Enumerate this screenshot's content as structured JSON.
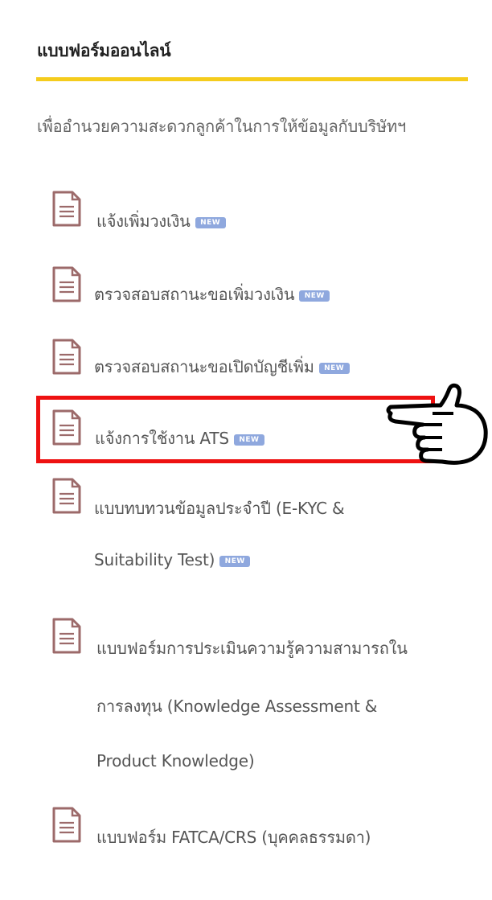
{
  "header": {
    "title": "แบบฟอร์มออนไลน์",
    "subtitle": "เพื่ออำนวยความสะดวกลูกค้าในการให้ข้อมูลกับบริษัทฯ"
  },
  "colors": {
    "accent_underline": "#f5cc1d",
    "highlight_border": "#ee1111",
    "icon_color": "#9c6a6a",
    "badge_color": "#8fa8de"
  },
  "new_badge_label": "NEW",
  "forms": [
    {
      "icon": "document-icon",
      "lines": [
        "แจ้งเพิ่มวงเงิน"
      ],
      "is_new": true
    },
    {
      "icon": "document-icon",
      "lines": [
        "ตรวจสอบสถานะขอเพิ่มวงเงิน"
      ],
      "is_new": true
    },
    {
      "icon": "document-icon",
      "lines": [
        "ตรวจสอบสถานะขอเปิดบัญชีเพิ่ม"
      ],
      "is_new": true
    },
    {
      "icon": "document-icon",
      "lines": [
        "แจ้งการใช้งาน ATS"
      ],
      "is_new": true,
      "highlighted": true
    },
    {
      "icon": "document-icon",
      "lines": [
        "แบบทบทวนข้อมูลประจำปี (E-KYC &",
        "Suitability Test)"
      ],
      "is_new": true
    },
    {
      "icon": "document-icon",
      "lines": [
        "แบบฟอร์มการประเมินความรู้ความสามารถใน",
        "การลงทุน (Knowledge Assessment &",
        "Product Knowledge)"
      ],
      "is_new": false
    },
    {
      "icon": "document-icon",
      "lines": [
        "แบบฟอร์ม FATCA/CRS (บุคคลธรรมดา)"
      ],
      "is_new": false
    }
  ],
  "annotation": {
    "hand_icon": "pointing-hand-icon"
  }
}
